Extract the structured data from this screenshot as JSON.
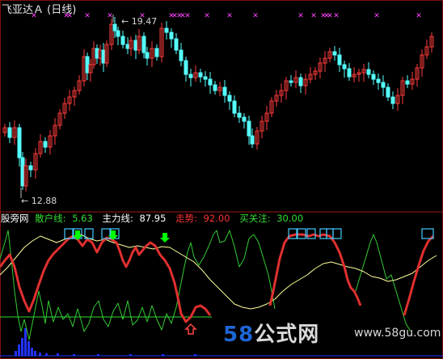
{
  "window": {
    "title": "飞亚达Ａ (日线)"
  },
  "main_chart": {
    "high_annotation": "19.47",
    "low_annotation": "12.88",
    "high_value": 19.47,
    "low_value": 12.88,
    "bull_color": "#ff3b3b",
    "bear_color": "#55ffff",
    "marker_color": "#ff44ff",
    "marker_glyph": "✕"
  },
  "indicator": {
    "name": "股旁网",
    "retail_label": "散户线:",
    "retail_value": "5.63",
    "main_label": "主力线:",
    "main_value": "87.95",
    "trend_label": "走势:",
    "trend_value": "92.00",
    "focus_label": "买关注:",
    "focus_value": "30.00",
    "colors": {
      "name": "#ffffff",
      "retail": "#33dd33",
      "main": "#ffffff",
      "trend": "#ff3333",
      "focus": "#33dd33",
      "trend_line": "#e03030",
      "retail_line": "#33cc33",
      "main_line": "#ffff99",
      "box": "#44ccff",
      "down_arrow": "#00ff00",
      "up_arrow": "#ff4444",
      "volume": "#2233ff"
    },
    "icons": [
      "down-arrow-icon",
      "up-arrow-icon",
      "signal-box-icon"
    ]
  },
  "watermark": {
    "number": "58",
    "text": "公式网",
    "url": "www.58gu.com"
  }
}
